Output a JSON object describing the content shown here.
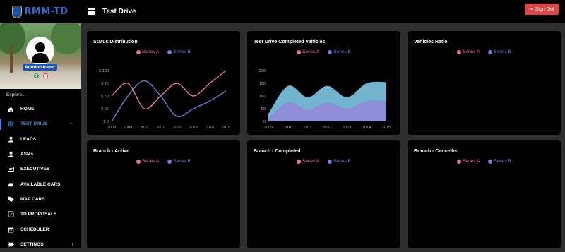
{
  "header": {
    "logo_text": "RMM-TD",
    "page_title": "Test Drive",
    "signout_label": "Sign Out"
  },
  "sidebar": {
    "role_badge": "Administrator",
    "explore_label": "Explore...",
    "items": [
      {
        "label": "HOME",
        "icon": "home-icon"
      },
      {
        "label": "TEST DRIVE",
        "icon": "map-signs-icon",
        "active": true,
        "arrow": "chevron-down"
      },
      {
        "label": "LEADS",
        "icon": "user-icon"
      },
      {
        "label": "ASMs",
        "icon": "user-icon"
      },
      {
        "label": "EXECUTIVES",
        "icon": "id-card-icon"
      },
      {
        "label": "AVAILABLE CARS",
        "icon": "car-icon"
      },
      {
        "label": "MAP CARS",
        "icon": "tag-icon"
      },
      {
        "label": "TD PROPOSALS",
        "icon": "note-icon"
      },
      {
        "label": "SCHEDULER",
        "icon": "calendar-icon"
      },
      {
        "label": "SETTINGS",
        "icon": "gear-icon",
        "arrow": "chevron-right"
      }
    ]
  },
  "colors": {
    "series_a": "#f06fa8",
    "series_b": "#6a7fd8",
    "area_a": "#7ec8e3",
    "area_b": "#8f8cd8",
    "signout": "#e04545",
    "active_nav": "#4d86e0"
  },
  "cards": [
    {
      "title": "Status Distribution",
      "legend": [
        "Series A",
        "Series B"
      ]
    },
    {
      "title": "Test Drive Completed Vehicles",
      "legend": [
        "Series A",
        "Series B"
      ]
    },
    {
      "title": "Vehicles Ratio",
      "legend": [
        "Series A",
        "Series B"
      ]
    },
    {
      "title": "Branch - Active",
      "legend": [
        "Series A",
        "Series B"
      ]
    },
    {
      "title": "Branch - Completed",
      "legend": [
        "Series A",
        "Series B"
      ]
    },
    {
      "title": "Branch - Cancelled",
      "legend": [
        "Series A",
        "Series B"
      ]
    }
  ],
  "chart_data": [
    {
      "type": "line",
      "x": [
        "2008",
        "2009",
        "2010",
        "2011",
        "2012",
        "2013",
        "2014",
        "2015"
      ],
      "y_ticks": [
        "$ 0",
        "$ 25",
        "$ 50",
        "$ 75",
        "$ 100"
      ],
      "ylim": [
        0,
        100
      ],
      "series": [
        {
          "name": "Series A",
          "values": [
            50,
            75,
            25,
            50,
            75,
            50,
            75,
            100
          ]
        },
        {
          "name": "Series B",
          "values": [
            0,
            50,
            80,
            50,
            10,
            25,
            40,
            60
          ]
        }
      ]
    },
    {
      "type": "area",
      "x": [
        "2009",
        "2010",
        "2011",
        "2012",
        "2013",
        "2014",
        "2015"
      ],
      "y_ticks": [
        "0",
        "50",
        "100",
        "150",
        "200"
      ],
      "ylim": [
        0,
        200
      ],
      "series": [
        {
          "name": "Series A",
          "values": [
            30,
            140,
            95,
            140,
            95,
            150,
            155
          ]
        },
        {
          "name": "Series B",
          "values": [
            10,
            75,
            45,
            75,
            50,
            80,
            80
          ]
        }
      ]
    }
  ]
}
